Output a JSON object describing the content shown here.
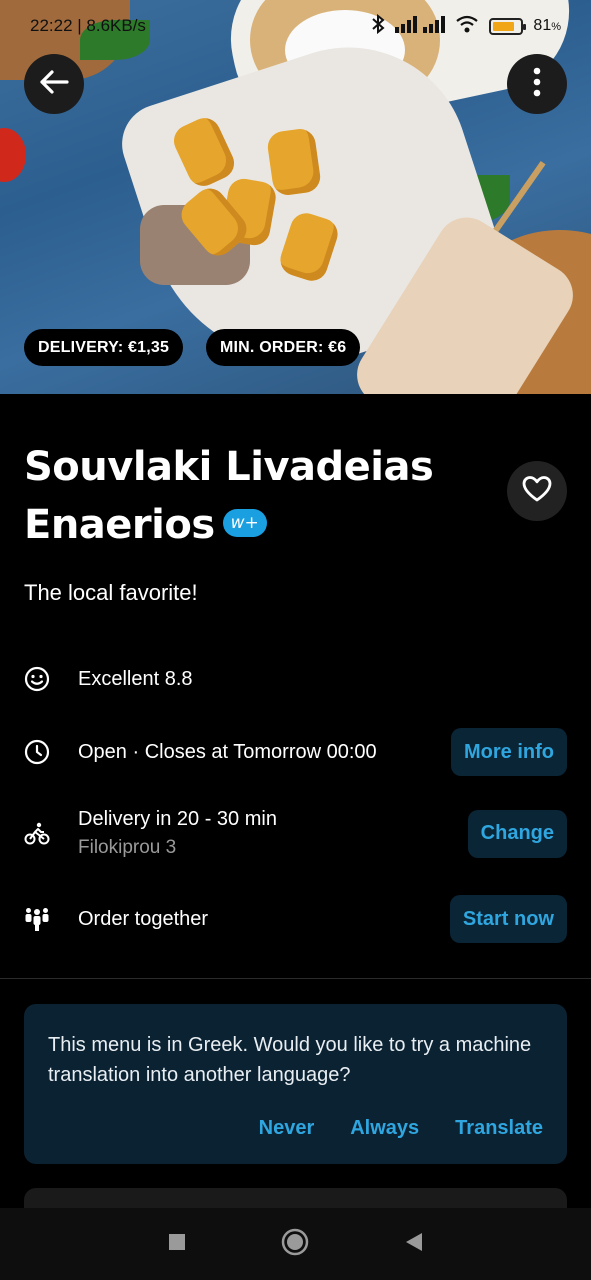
{
  "status_bar": {
    "time_speed": "22:22 | 8.6KB/s",
    "battery_percent": "81",
    "battery_suffix": "%",
    "battery_level": 0.81
  },
  "hero": {
    "delivery_fee": "DELIVERY: €1,35",
    "min_order": "MIN. ORDER: €6"
  },
  "restaurant": {
    "name_line1": "Souvlaki Livadeias",
    "name_line2": "Enaerios",
    "badge": "w+",
    "tagline": "The local favorite!"
  },
  "info": {
    "rating": "Excellent 8.8",
    "hours": "Open · Closes at Tomorrow 00:00",
    "hours_action": "More info",
    "delivery": "Delivery in 20 - 30 min",
    "address": "Filokiprou 3",
    "delivery_action": "Change",
    "group_order": "Order together",
    "group_action": "Start now"
  },
  "translate": {
    "message": "This menu is in Greek. Would you like to try a machine translation into another language?",
    "never": "Never",
    "always": "Always",
    "translate": "Translate"
  },
  "colors": {
    "accent": "#2fa6df",
    "action_bg": "#0a2536",
    "card_bg": "#0b2233",
    "badge": "#1a9fe0"
  },
  "icons": [
    "arrow-left-icon",
    "more-vertical-icon",
    "heart-icon",
    "smiley-icon",
    "clock-icon",
    "bicycle-icon",
    "group-icon",
    "square-icon",
    "circle-icon",
    "triangle-back-icon"
  ]
}
